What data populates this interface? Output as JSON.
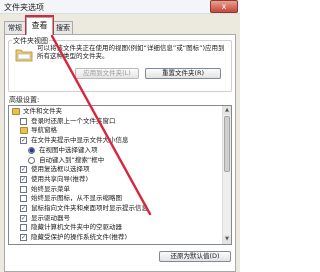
{
  "window": {
    "title": "文件夹选项",
    "close_glyph": "x"
  },
  "tabs": [
    {
      "label": "常规",
      "active": false
    },
    {
      "label": "查看",
      "active": true
    },
    {
      "label": "搜索",
      "active": false
    }
  ],
  "folder_views": {
    "legend": "文件夹视图",
    "description": "可以将该文件夹正在使用的视图(例如“详细信息”或“图标”)应用到所有这种类型的文件夹。",
    "apply_button": "应用到文件夹(L)",
    "reset_button": "重置文件夹(R)"
  },
  "advanced": {
    "label": "高级设置:",
    "items": [
      {
        "kind": "folder",
        "indent": 0,
        "text": "文件和文件夹"
      },
      {
        "kind": "checkbox",
        "indent": 1,
        "checked": false,
        "text": "登录时还原上一个文件夹窗口"
      },
      {
        "kind": "folder",
        "indent": 1,
        "text": "导航窗格"
      },
      {
        "kind": "checkbox",
        "indent": 1,
        "checked": true,
        "text": "在文件夹提示中显示文件大小信息"
      },
      {
        "kind": "radio",
        "indent": 2,
        "checked": true,
        "text": "在视图中选择键入项"
      },
      {
        "kind": "radio",
        "indent": 2,
        "checked": false,
        "text": "自动键入到“搜索”框中"
      },
      {
        "kind": "checkbox",
        "indent": 1,
        "checked": true,
        "text": "使用复选框以选择项"
      },
      {
        "kind": "checkbox",
        "indent": 1,
        "checked": true,
        "text": "使用共享向导(推荐)"
      },
      {
        "kind": "checkbox",
        "indent": 1,
        "checked": false,
        "text": "始终显示菜单"
      },
      {
        "kind": "checkbox",
        "indent": 1,
        "checked": false,
        "text": "始终显示图标，从不显示缩略图"
      },
      {
        "kind": "checkbox",
        "indent": 1,
        "checked": true,
        "text": "鼠标指向文件夹和桌面项时显示提示信息"
      },
      {
        "kind": "checkbox",
        "indent": 1,
        "checked": true,
        "text": "显示驱动器号"
      },
      {
        "kind": "checkbox",
        "indent": 1,
        "checked": false,
        "text": "隐藏计算机文件夹中的空驱动器"
      },
      {
        "kind": "checkbox",
        "indent": 1,
        "checked": true,
        "text": "隐藏受保护的操作系统文件(推荐)"
      }
    ],
    "restore_button": "还原为默认值(D)"
  },
  "annotation": {
    "color": "#d7263d"
  }
}
